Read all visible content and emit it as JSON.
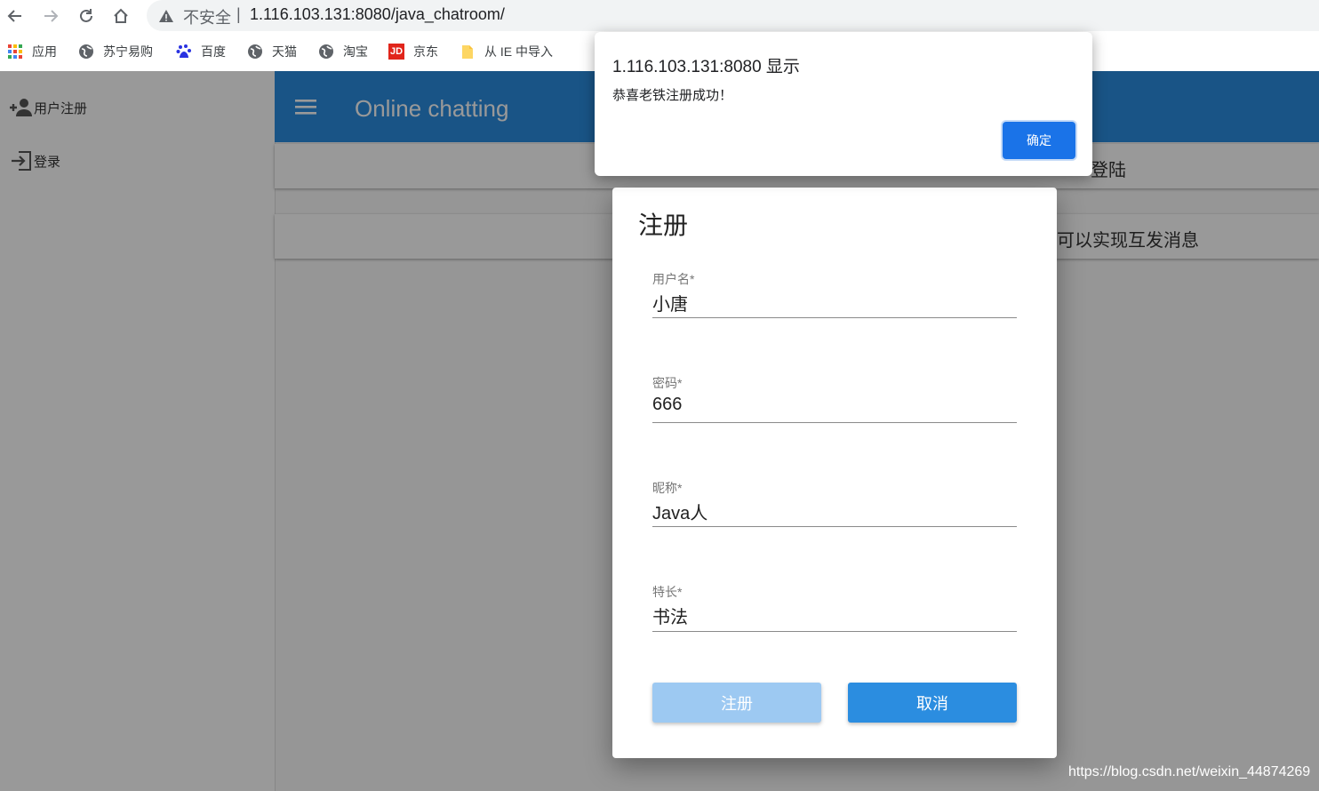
{
  "browser": {
    "url_warning": "不安全",
    "url_separator": "|",
    "url": "1.116.103.131:8080/java_chatroom/",
    "bookmarks": [
      {
        "label": "应用",
        "icon": "apps-grid-icon"
      },
      {
        "label": "苏宁易购",
        "icon": "globe-icon"
      },
      {
        "label": "百度",
        "icon": "baidu-paw-icon"
      },
      {
        "label": "天猫",
        "icon": "globe-icon"
      },
      {
        "label": "淘宝",
        "icon": "globe-icon"
      },
      {
        "label": "京东",
        "icon": "jd-logo-icon"
      },
      {
        "label": "从 IE 中导入",
        "icon": "folder-icon"
      }
    ]
  },
  "sidebar": {
    "items": [
      {
        "label": "用户注册",
        "icon": "person-add-icon"
      },
      {
        "label": "登录",
        "icon": "login-icon"
      }
    ]
  },
  "appbar": {
    "title": "Online chatting"
  },
  "cards": [
    {
      "text": "登陆"
    },
    {
      "text": "可以实现互发消息"
    }
  ],
  "dialog": {
    "title": "注册",
    "fields": [
      {
        "label": "用户名*",
        "value": "小唐"
      },
      {
        "label": "密码*",
        "value": "666"
      },
      {
        "label": "昵称*",
        "value": "Java人"
      },
      {
        "label": "特长*",
        "value": "书法"
      }
    ],
    "register_label": "注册",
    "cancel_label": "取消"
  },
  "alert": {
    "title": "1.116.103.131:8080 显示",
    "message": "恭喜老铁注册成功！",
    "ok_label": "确定"
  },
  "watermark": "https://blog.csdn.net/weixin_44874269",
  "colors": {
    "appbar": "#2b8de0",
    "primary_button": "#2b8de0",
    "alert_button": "#1a73e8"
  }
}
